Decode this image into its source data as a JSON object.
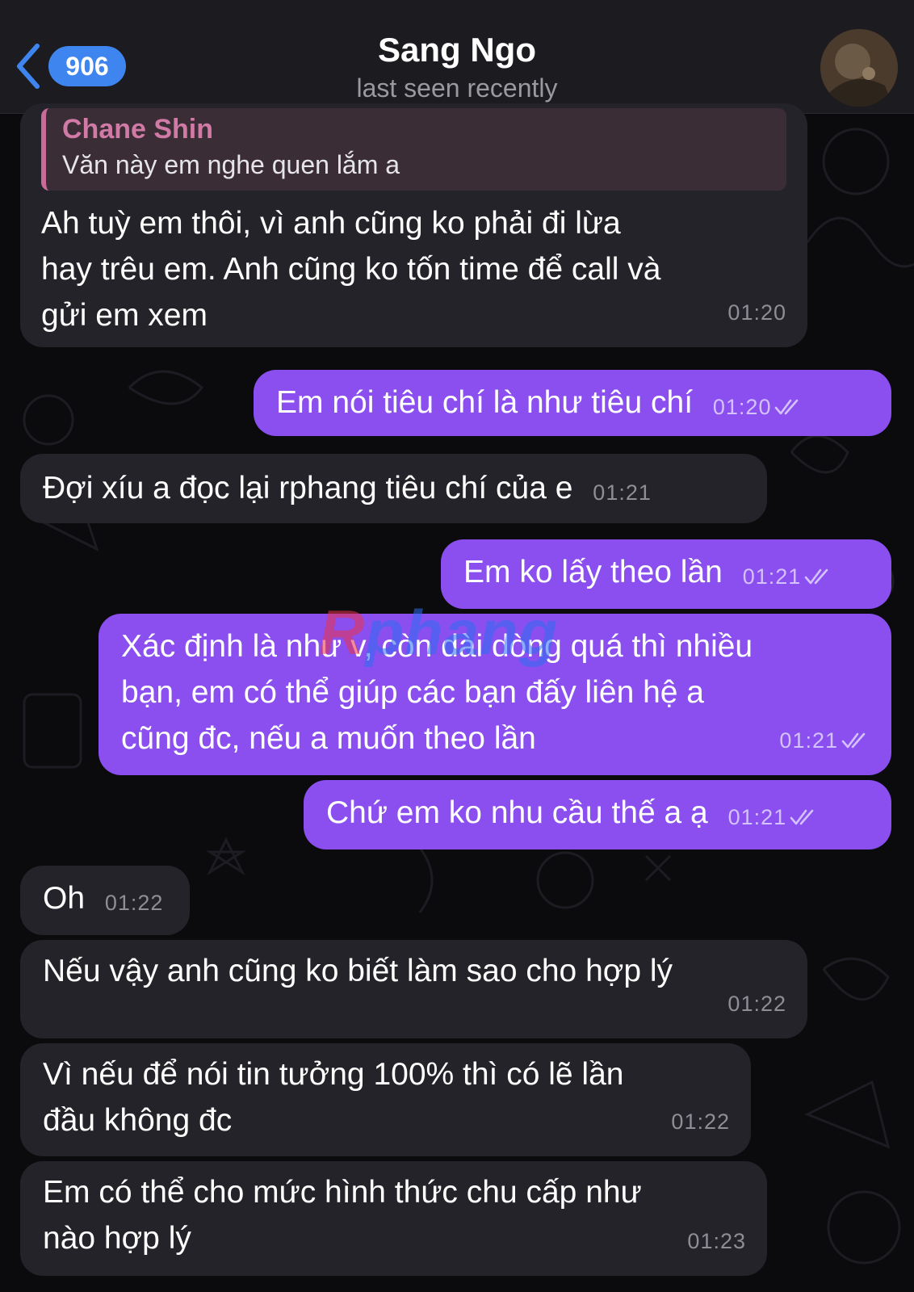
{
  "header": {
    "unread_count": "906",
    "title": "Sang Ngo",
    "status": "last seen recently"
  },
  "watermark": {
    "r": "R",
    "rest": "phang"
  },
  "messages": [
    {
      "direction": "in",
      "quote_author": "Chane Shin",
      "quote_text": "Văn này em nghe quen lắm a",
      "text": "Ah tuỳ em thôi, vì anh cũng ko phải đi lừa\nhay trêu em. Anh cũng ko tốn time để call và\ngửi em xem",
      "time": "01:20"
    },
    {
      "direction": "out",
      "text": "Em nói tiêu chí là như tiêu chí",
      "time": "01:20",
      "read": true
    },
    {
      "direction": "in",
      "text": "Đợi xíu a đọc lại rphang tiêu chí của e",
      "time": "01:21"
    },
    {
      "direction": "out",
      "text": "Em ko lấy theo lần",
      "time": "01:21",
      "read": true
    },
    {
      "direction": "out",
      "text": "Xác định là như v, còn dài dòng quá thì nhiều\nbạn, em có thể giúp các bạn đấy liên hệ a\ncũng đc, nếu a muốn theo lần",
      "time": "01:21",
      "read": true
    },
    {
      "direction": "out",
      "text": "Chứ em ko nhu cầu thế a ạ",
      "time": "01:21",
      "read": true
    },
    {
      "direction": "in",
      "text": "Oh",
      "time": "01:22"
    },
    {
      "direction": "in",
      "text": "Nếu vậy anh cũng ko biết làm sao cho hợp lý",
      "time": "01:22"
    },
    {
      "direction": "in",
      "text": "Vì nếu để nói tin tưởng 100% thì có lẽ lần\nđầu không đc",
      "time": "01:22"
    },
    {
      "direction": "in",
      "text": "Em có thể cho mức hình thức chu cấp như\nnào hợp lý",
      "time": "01:23"
    }
  ],
  "colors": {
    "incoming_bubble": "#242329",
    "outgoing_bubble": "#8b4ff0",
    "badge": "#3f85f0",
    "quote_accent": "#c96a98"
  }
}
